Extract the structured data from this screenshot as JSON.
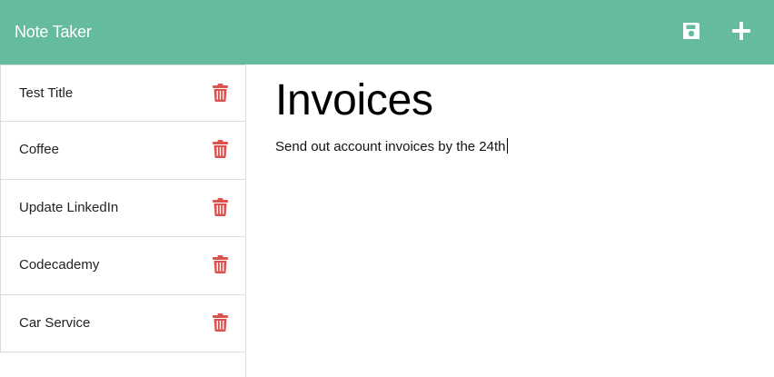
{
  "app": {
    "brand": "Note Taker"
  },
  "toolbar": {
    "save_icon": "save-icon",
    "new_icon": "plus-icon"
  },
  "colors": {
    "navbar": "#64bc9c",
    "trash": "#d9534f",
    "brand_text": "#ffffff"
  },
  "notes": [
    {
      "title": "Test Title"
    },
    {
      "title": "Coffee"
    },
    {
      "title": "Update LinkedIn"
    },
    {
      "title": "Codecademy"
    },
    {
      "title": "Car Service"
    }
  ],
  "active_note": {
    "title": "Invoices",
    "text": "Send out account invoices by the 24th"
  }
}
